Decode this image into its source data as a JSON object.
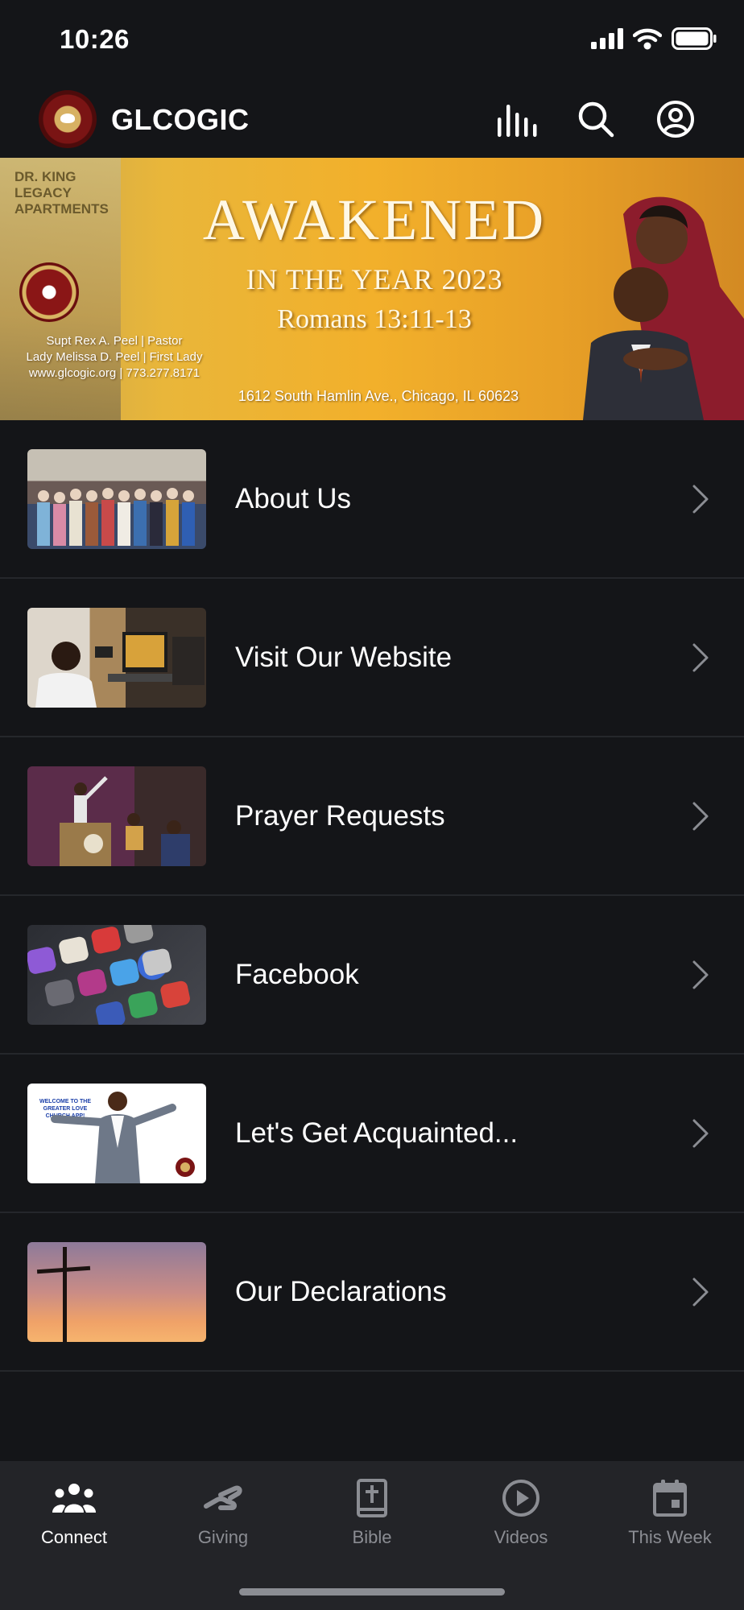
{
  "status_bar": {
    "time": "10:26",
    "icons": [
      "signal-icon",
      "wifi-icon",
      "battery-icon"
    ]
  },
  "header": {
    "title": "GLCOGIC",
    "icons": [
      "equalizer-icon",
      "search-icon",
      "profile-icon"
    ]
  },
  "banner": {
    "building_sign": "DR. KING LEGACY APARTMENTS",
    "headline": "AWAKENED",
    "subheadline": "IN THE YEAR 2023",
    "scripture": "Romans 13:11-13",
    "pastor": "Supt Rex A. Peel | Pastor",
    "first_lady": "Lady Melissa D. Peel | First Lady",
    "contact": "www.glcogic.org | 773.277.8171",
    "address": "1612 South Hamlin Ave., Chicago, IL 60623"
  },
  "menu": {
    "items": [
      {
        "label": "About Us",
        "thumb": "church-group-photo"
      },
      {
        "label": "Visit Our Website",
        "thumb": "child-at-computer-photo"
      },
      {
        "label": "Prayer Requests",
        "thumb": "worship-stage-photo"
      },
      {
        "label": "Facebook",
        "thumb": "social-apps-photo"
      },
      {
        "label": "Let's Get Acquainted...",
        "thumb": "pastor-welcome-photo"
      },
      {
        "label": "Our Declarations",
        "thumb": "cross-sunset-photo"
      }
    ],
    "acquainted_caption": "WELCOME TO THE GREATER LOVE CHURCH APP!"
  },
  "tabs": [
    {
      "label": "Connect",
      "icon": "people-icon",
      "active": true
    },
    {
      "label": "Giving",
      "icon": "giving-hand-icon",
      "active": false
    },
    {
      "label": "Bible",
      "icon": "bible-icon",
      "active": false
    },
    {
      "label": "Videos",
      "icon": "play-circle-icon",
      "active": false
    },
    {
      "label": "This Week",
      "icon": "calendar-icon",
      "active": false
    }
  ],
  "colors": {
    "background": "#141518",
    "tab_bar": "#232428",
    "divider": "#25272b",
    "tab_inactive": "#8b8d93",
    "banner_gold": "#f2b02b"
  }
}
